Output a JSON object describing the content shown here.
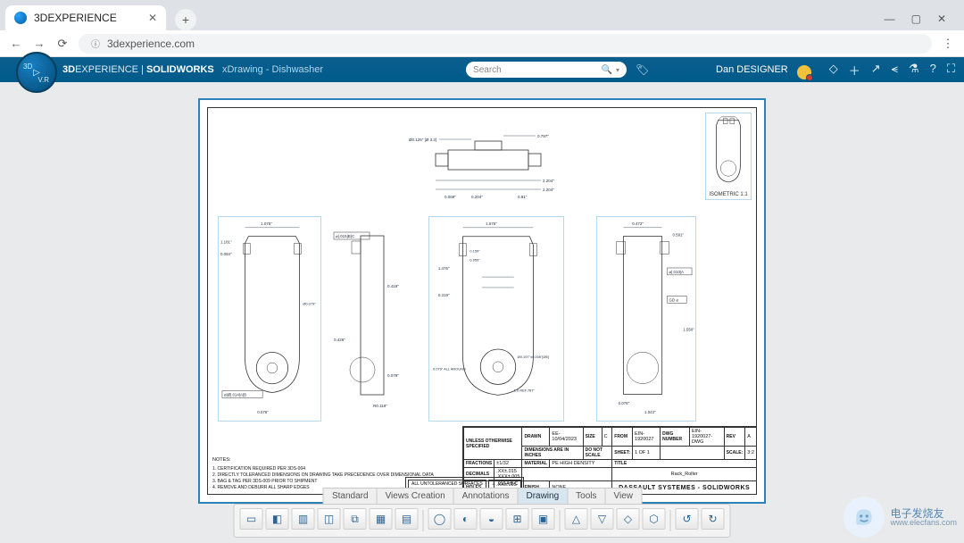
{
  "chrome": {
    "tab_title": "3DEXPERIENCE",
    "new_tab": "+",
    "win": {
      "min": "—",
      "max": "▢",
      "close": "✕"
    },
    "nav": {
      "back": "←",
      "fwd": "→",
      "reload": "⟳"
    },
    "url": "3dexperience.com",
    "menu": "⋮"
  },
  "header": {
    "brand_bold1": "3D",
    "brand_rest1": "EXPERIENCE",
    "sep": " | ",
    "brand_bold2": "SOLIDWORKS",
    "doc": "xDrawing - Dishwasher",
    "search_placeholder": "Search",
    "user": "Dan DESIGNER",
    "compass": {
      "tl": "3D",
      "br": "V.R",
      "play": "▷"
    }
  },
  "views": {
    "iso_label": "ISOMETRIC\n1:1",
    "top": {
      "d1": "0.797\"",
      "d2": "Ø0.125\" [Ø 3.2]",
      "d3": "2.204\"",
      "d4": "2.204\"",
      "d5": "0.81\"",
      "d6": "0.069\"",
      "d7": "0.204\""
    },
    "v1": {
      "w": "1.075\"",
      "h1": "1.181\"",
      "h2": "0.084\"",
      "r": "Ø0.079\"",
      "gd": "⌀|Ø|.014|A|B",
      "b": "0.076\""
    },
    "v2": {
      "fcf": "⌀|.015|B|C",
      "h": "0.426\"",
      "r": "R0.118\"",
      "d": "0.079\"",
      "d2": "0.419\""
    },
    "v3": {
      "w": "1.575\"",
      "d1": "1.476\"",
      "d2": "0.319\"",
      "d3": "0.959\"",
      "d4": "0.159\"",
      "r": "0.079\" ALL AROUND",
      "d5": "Ø0.197\"±0.005\"[Ø5]",
      "note": "1.0 REF.787\""
    },
    "v4": {
      "w": "0.472\"",
      "e": "0.591\"",
      "fcf1": "⌀|.010|A",
      "gd": "GD ⌀",
      "h": "1.550\"",
      "b1": "0.076\"",
      "b2": "1.043\""
    }
  },
  "titleblock": {
    "r1": {
      "l1": "UNLESS OTHERWISE",
      "l2": "SPECIFIED",
      "drawn": "DRAWN",
      "drawn_v": "EE-10/04/2023",
      "size": "SIZE",
      "size_v": "C",
      "from": "FROM",
      "from_v": "EIN-1920027",
      "num": "DWG NUMBER",
      "num_v": "EIN-1920027-DWG",
      "rev": "REV",
      "rev_v": "A"
    },
    "r2": {
      "dim": "DIMENSIONS ARE IN INCHES",
      "dns": "DO NOT SCALE",
      "sheet": "SHEET:",
      "sheet_v": "1 OF 1",
      "scale": "SCALE:",
      "scale_v": "3:2"
    },
    "r3": {
      "frac": "FRACTIONS",
      "frac_v": "±1/32",
      "mat": "MATERIAL",
      "mat_v": "PE HIGH DENSITY",
      "title_l": "TITLE"
    },
    "r4": {
      "dec": "DECIMALS",
      "dec_v1": ".XX±.015",
      "dec_v2": ".XXX±.005",
      "title_v": "Rack_Roller"
    },
    "r5": {
      "holes": "HOLES",
      "holes_v1": ".XX±.005",
      "holes_v2": ".XXX±.003",
      "fin": "FINISH",
      "fin_v": "NONE",
      "company": "DASSAULT SYSTEMES - SOLIDWORKS"
    }
  },
  "notes": {
    "hd": "NOTES:",
    "n1": "1. CERTIFICATION REQUIRED PER 3DS-004",
    "n2": "2. DIRECTLY TOLERANCED DIMENSIONS ON DRAWING TAKE PRECEDENCE OVER DIMENSIONAL DATA",
    "n3": "3. BAG & TAG PER 3DS-009 PRIOR TO SHIPMENT",
    "n4": "4. REMOVE AND DEBURR ALL SHARP EDGES",
    "surf_l": "ALL UNTOLERANCED SURFACES",
    "surf_v": "⊥ .010 A B C"
  },
  "cmdbar": {
    "tabs": [
      "Standard",
      "Views Creation",
      "Annotations",
      "Drawing",
      "Tools",
      "View"
    ],
    "active": 3,
    "buttons": [
      "▭",
      "◧",
      "▥",
      "◫",
      "⧉",
      "▦",
      "▤",
      "|",
      "◯",
      "◐",
      "◒",
      "⊞",
      "▣",
      "|",
      "△",
      "▽",
      "◇",
      "⬡",
      "|",
      "↺",
      "↻"
    ]
  },
  "watermark": {
    "line1": "电子发烧友",
    "line2": "www.elecfans.com"
  }
}
